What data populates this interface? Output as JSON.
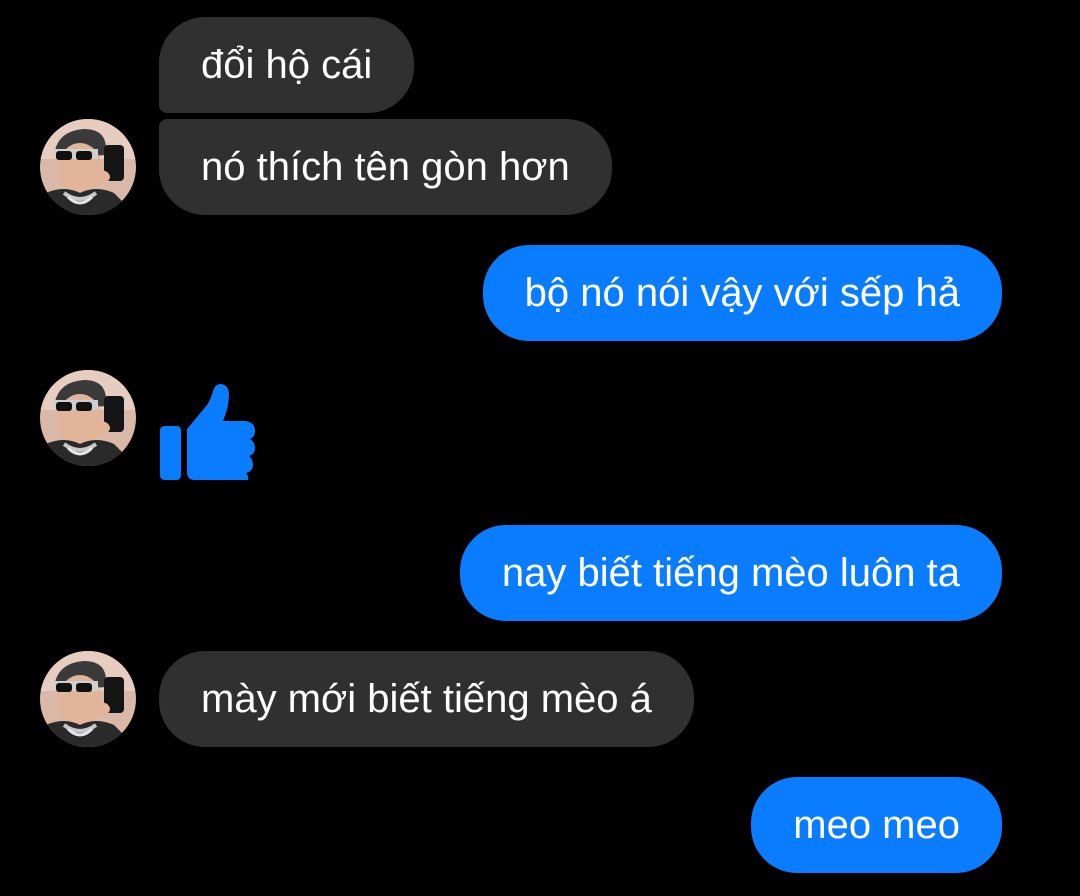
{
  "conversation": {
    "messages": [
      {
        "sender": "contact",
        "type": "text",
        "text": "đổi hộ cái"
      },
      {
        "sender": "contact",
        "type": "text",
        "text": "nó thích tên gòn hơn"
      },
      {
        "sender": "me",
        "type": "text",
        "text": "bộ nó nói vậy với sếp hả"
      },
      {
        "sender": "contact",
        "type": "like",
        "icon": "thumbs-up-icon"
      },
      {
        "sender": "me",
        "type": "text",
        "text": "nay biết tiếng mèo luôn ta"
      },
      {
        "sender": "contact",
        "type": "text",
        "text": "mày mới biết tiếng mèo á"
      },
      {
        "sender": "me",
        "type": "text",
        "text": "meo meo"
      }
    ]
  },
  "colors": {
    "background": "#000000",
    "incoming_bubble": "#303030",
    "outgoing_bubble": "#0a7cff",
    "like_icon": "#0a7cff",
    "text": "#ffffff"
  }
}
